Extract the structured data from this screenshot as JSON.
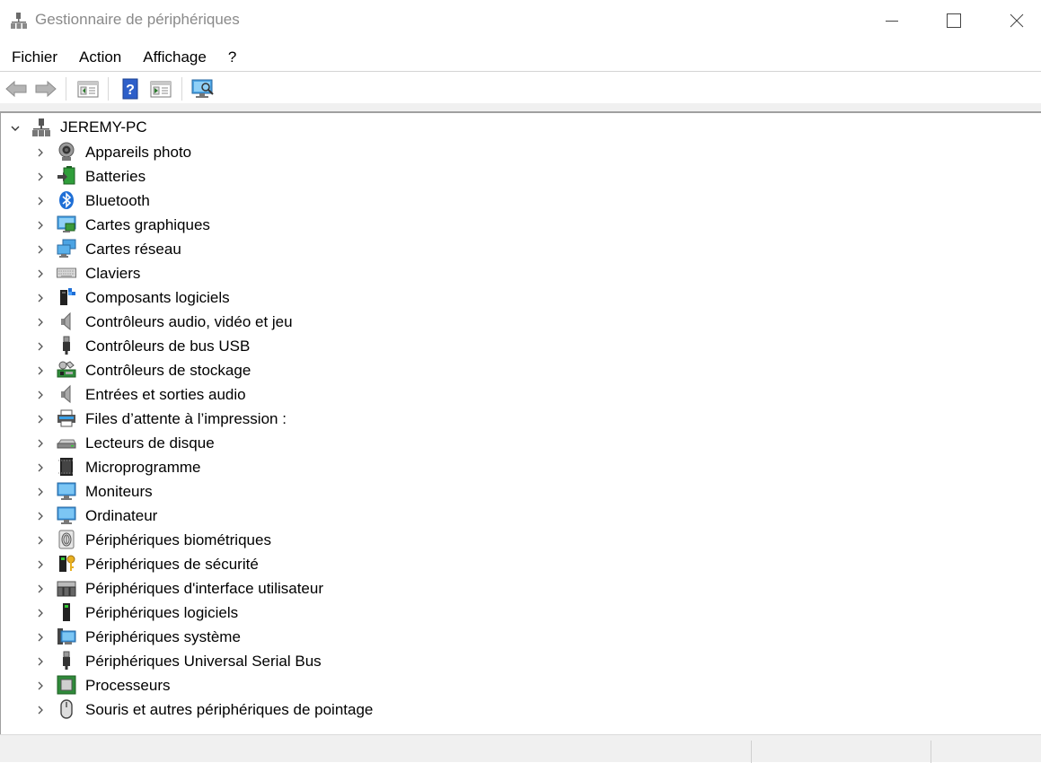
{
  "window": {
    "title": "Gestionnaire de périphériques",
    "icon": "device-manager-icon"
  },
  "menu": {
    "items": [
      {
        "label": "Fichier"
      },
      {
        "label": "Action"
      },
      {
        "label": "Affichage"
      },
      {
        "label": "?"
      }
    ]
  },
  "toolbar": {
    "buttons": [
      {
        "icon": "back-arrow-icon"
      },
      {
        "icon": "forward-arrow-icon"
      },
      {
        "icon": "properties-icon"
      },
      {
        "icon": "help-icon"
      },
      {
        "icon": "run-icon"
      },
      {
        "icon": "scan-hardware-icon"
      }
    ]
  },
  "tree": {
    "root": {
      "label": "JEREMY-PC",
      "icon": "computer-tower-icon",
      "expanded": true
    },
    "items": [
      {
        "label": "Appareils photo",
        "icon": "camera-icon"
      },
      {
        "label": "Batteries",
        "icon": "battery-icon"
      },
      {
        "label": "Bluetooth",
        "icon": "bluetooth-icon"
      },
      {
        "label": "Cartes graphiques",
        "icon": "display-adapter-icon"
      },
      {
        "label": "Cartes réseau",
        "icon": "network-adapter-icon"
      },
      {
        "label": "Claviers",
        "icon": "keyboard-icon"
      },
      {
        "label": "Composants logiciels",
        "icon": "software-component-icon"
      },
      {
        "label": "Contrôleurs audio, vidéo et jeu",
        "icon": "speaker-icon"
      },
      {
        "label": "Contrôleurs de bus USB",
        "icon": "usb-icon"
      },
      {
        "label": "Contrôleurs de stockage",
        "icon": "storage-controller-icon"
      },
      {
        "label": "Entrées et sorties audio",
        "icon": "audio-io-icon"
      },
      {
        "label": "Files d’attente à l’impression :",
        "icon": "printer-icon"
      },
      {
        "label": "Lecteurs de disque",
        "icon": "disk-drive-icon"
      },
      {
        "label": "Microprogramme",
        "icon": "firmware-chip-icon"
      },
      {
        "label": "Moniteurs",
        "icon": "monitor-icon"
      },
      {
        "label": "Ordinateur",
        "icon": "computer-icon"
      },
      {
        "label": "Périphériques biométriques",
        "icon": "fingerprint-icon"
      },
      {
        "label": "Périphériques de sécurité",
        "icon": "security-key-icon"
      },
      {
        "label": "Périphériques d'interface utilisateur",
        "icon": "hid-icon"
      },
      {
        "label": "Périphériques logiciels",
        "icon": "software-device-icon"
      },
      {
        "label": "Périphériques système",
        "icon": "system-device-icon"
      },
      {
        "label": "Périphériques Universal Serial Bus",
        "icon": "usb-device-icon"
      },
      {
        "label": "Processeurs",
        "icon": "processor-icon"
      },
      {
        "label": "Souris et autres périphériques de pointage",
        "icon": "mouse-icon"
      }
    ]
  }
}
